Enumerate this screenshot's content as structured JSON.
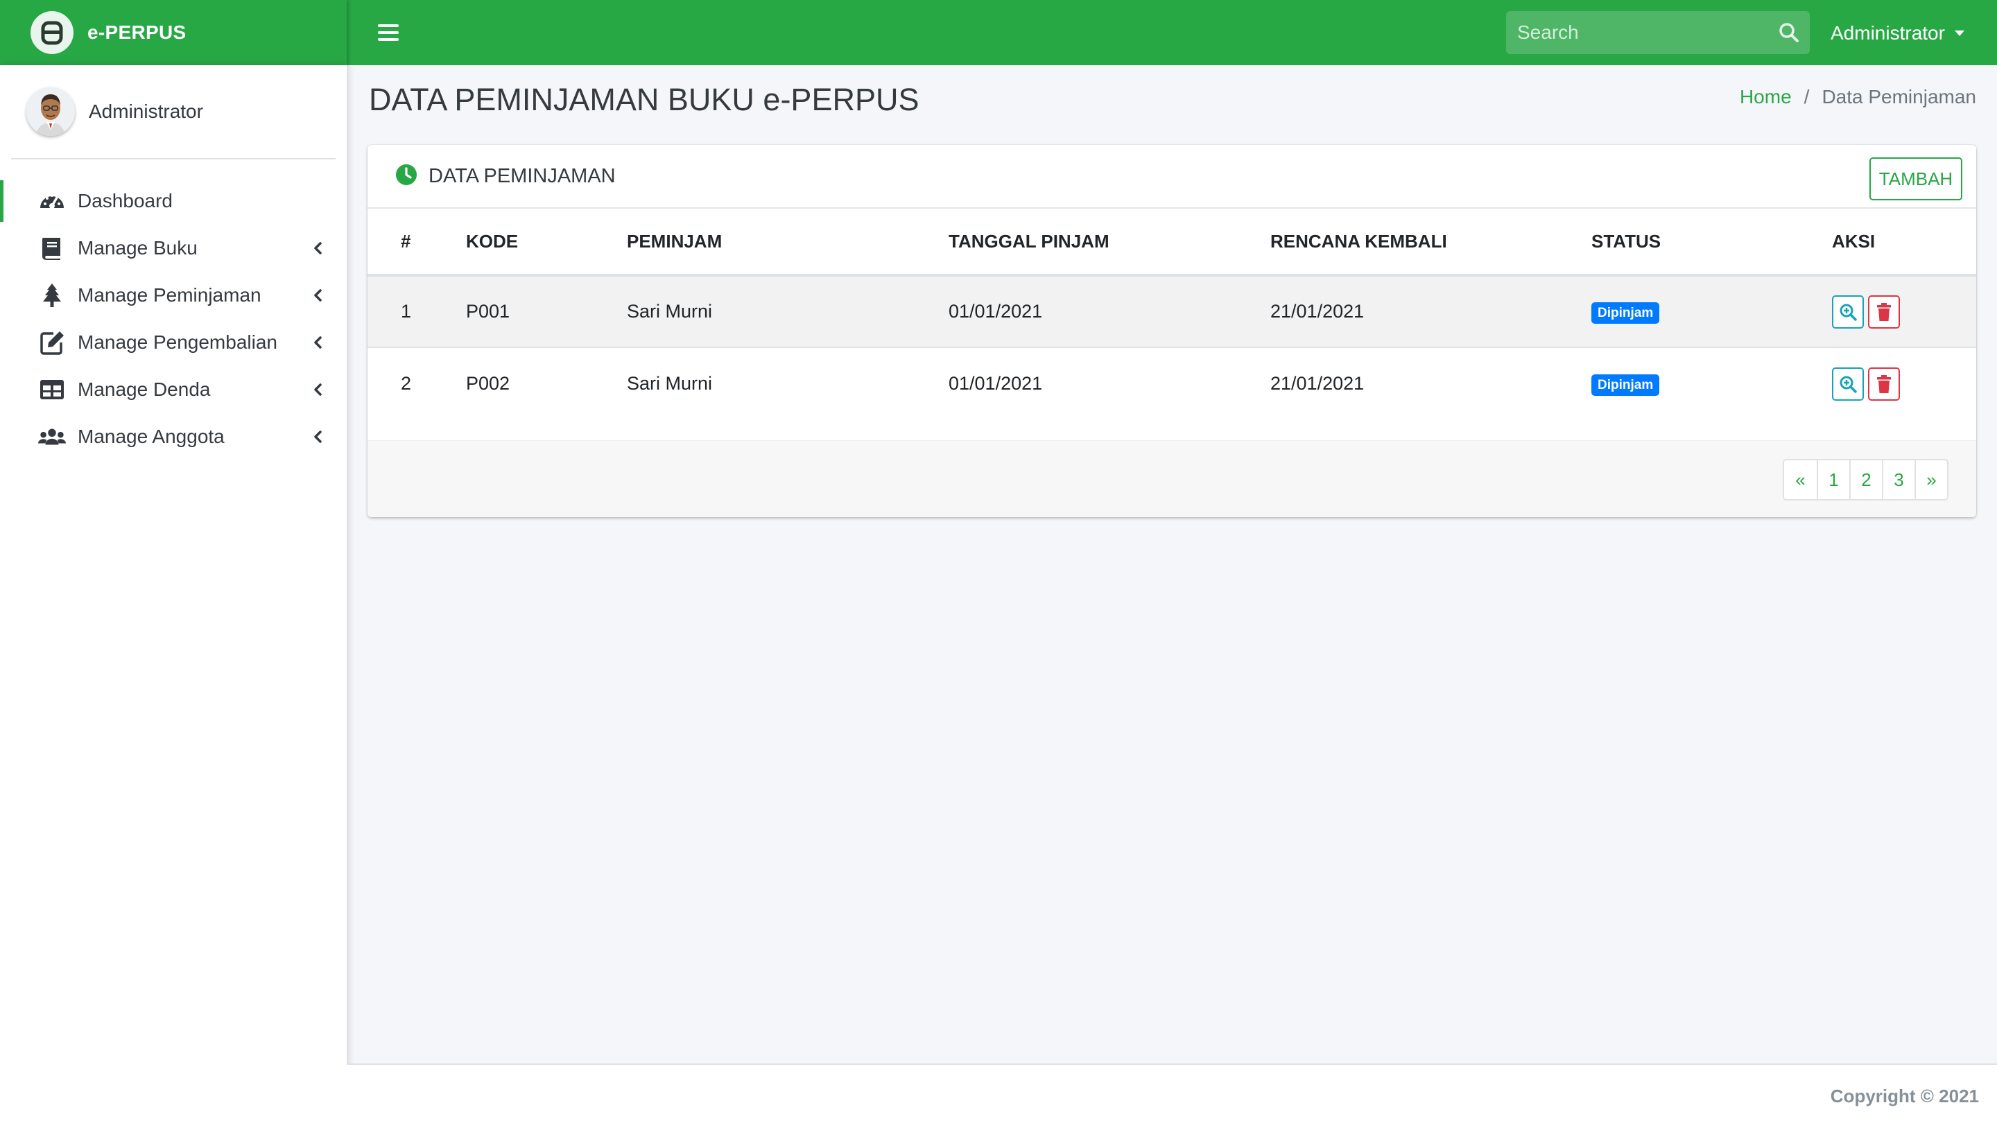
{
  "brand": {
    "name": "e-PERPUS"
  },
  "navbar": {
    "search_placeholder": "Search",
    "user_label": "Administrator"
  },
  "sidebar": {
    "user_name": "Administrator",
    "items": [
      {
        "label": "Dashboard",
        "icon": "tachometer-icon",
        "active": true
      },
      {
        "label": "Manage Buku",
        "icon": "book-icon"
      },
      {
        "label": "Manage Peminjaman",
        "icon": "tree-icon"
      },
      {
        "label": "Manage Pengembalian",
        "icon": "edit-icon"
      },
      {
        "label": "Manage Denda",
        "icon": "table-icon"
      },
      {
        "label": "Manage Anggota",
        "icon": "users-icon"
      }
    ]
  },
  "page": {
    "title": "DATA PEMINJAMAN BUKU e-PERPUS",
    "breadcrumb": {
      "home": "Home",
      "separator": "/",
      "current": "Data Peminjaman"
    }
  },
  "card": {
    "title": "DATA PEMINJAMAN",
    "add_button": "TAMBAH",
    "table": {
      "headers": [
        "#",
        "KODE",
        "PEMINJAM",
        "TANGGAL PINJAM",
        "RENCANA KEMBALI",
        "STATUS",
        "AKSI"
      ],
      "rows": [
        {
          "no": "1",
          "kode": "P001",
          "peminjam": "Sari Murni",
          "tanggal_pinjam": "01/01/2021",
          "rencana_kembali": "21/01/2021",
          "status": "Dipinjam"
        },
        {
          "no": "2",
          "kode": "P002",
          "peminjam": "Sari Murni",
          "tanggal_pinjam": "01/01/2021",
          "rencana_kembali": "21/01/2021",
          "status": "Dipinjam"
        }
      ]
    },
    "pagination": [
      "«",
      "1",
      "2",
      "3",
      "»"
    ]
  },
  "footer": {
    "copyright": "Copyright © 2021"
  },
  "colors": {
    "primary": "#28a745",
    "badge": "#007bff",
    "info": "#17a2b8",
    "danger": "#dc3545"
  }
}
